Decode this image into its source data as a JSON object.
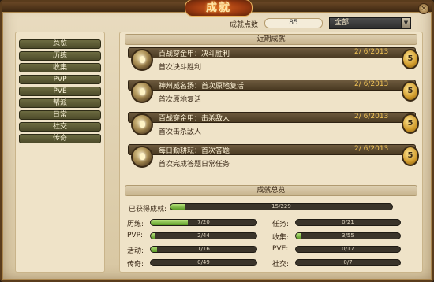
{
  "window": {
    "title": "成就",
    "close_glyph": "×"
  },
  "header": {
    "points_label": "成就点数",
    "points_value": "85",
    "filter_selected": "全部",
    "filter_arrow": "▼"
  },
  "sidebar": {
    "items": [
      {
        "label": "总览"
      },
      {
        "label": "历练"
      },
      {
        "label": "收集"
      },
      {
        "label": "PVP"
      },
      {
        "label": "PVE"
      },
      {
        "label": "帮派"
      },
      {
        "label": "日常"
      },
      {
        "label": "社交"
      },
      {
        "label": "传奇"
      }
    ]
  },
  "recent": {
    "title": "近期成就",
    "items": [
      {
        "name": "百战穿金甲：决斗胜利",
        "desc": "首次决斗胜利",
        "date": "2/ 6/2013",
        "points": "5",
        "icon": "trophy-icon"
      },
      {
        "name": "神州威名扬：首次原地复活",
        "desc": "首次原地复活",
        "date": "2/ 6/2013",
        "points": "5",
        "icon": "trophy-icon"
      },
      {
        "name": "百战穿金甲：击杀敌人",
        "desc": "首次击杀敌人",
        "date": "2/ 6/2013",
        "points": "5",
        "icon": "trophy-icon"
      },
      {
        "name": "每日勤耕耘：首次答题",
        "desc": "首次完成答题日常任务",
        "date": "2/ 6/2013",
        "points": "5",
        "icon": "trophy-icon"
      }
    ]
  },
  "summary": {
    "title": "成就总览",
    "overall": {
      "label": "已获得成就:",
      "text": "15/229",
      "progress": 0.066
    },
    "stats": [
      {
        "label": "历练:",
        "text": "7/20",
        "progress": 0.35
      },
      {
        "label": "任务:",
        "text": "0/21",
        "progress": 0.0
      },
      {
        "label": "PVP:",
        "text": "2/44",
        "progress": 0.045
      },
      {
        "label": "收集:",
        "text": "3/55",
        "progress": 0.055
      },
      {
        "label": "活动:",
        "text": "1/16",
        "progress": 0.0625
      },
      {
        "label": "PVE:",
        "text": "0/17",
        "progress": 0.0
      },
      {
        "label": "传奇:",
        "text": "0/49",
        "progress": 0.0
      },
      {
        "label": "社交:",
        "text": "0/7",
        "progress": 0.0
      }
    ]
  },
  "colors": {
    "accent_gold": "#f2c456",
    "progress_green": "#5a9a26",
    "button_olive": "#4d4b2a"
  }
}
